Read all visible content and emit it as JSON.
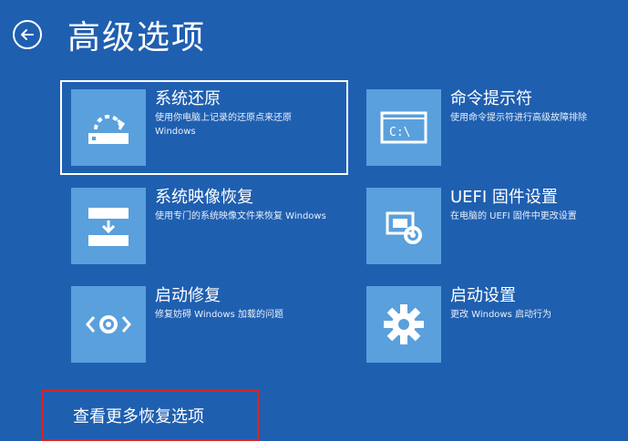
{
  "header": {
    "title": "高级选项",
    "back_icon": "back-arrow-icon"
  },
  "tiles": [
    {
      "title": "系统还原",
      "desc": "使用你电脑上记录的还原点来还原 Windows",
      "icon": "system-restore-icon"
    },
    {
      "title": "命令提示符",
      "desc": "使用命令提示符进行高级故障排除",
      "icon": "command-prompt-icon"
    },
    {
      "title": "系统映像恢复",
      "desc": "使用专门的系统映像文件来恢复 Windows",
      "icon": "system-image-icon"
    },
    {
      "title": "UEFI 固件设置",
      "desc": "在电脑的 UEFI 固件中更改设置",
      "icon": "uefi-firmware-icon"
    },
    {
      "title": "启动修复",
      "desc": "修复妨碍 Windows 加载的问题",
      "icon": "startup-repair-icon"
    },
    {
      "title": "启动设置",
      "desc": "更改 Windows 启动行为",
      "icon": "startup-settings-icon"
    }
  ],
  "more_options": {
    "label": "查看更多恢复选项"
  },
  "colors": {
    "background": "#1f5fb0",
    "tile_icon_bg": "#5aa0dc",
    "highlight": "#e02020"
  }
}
